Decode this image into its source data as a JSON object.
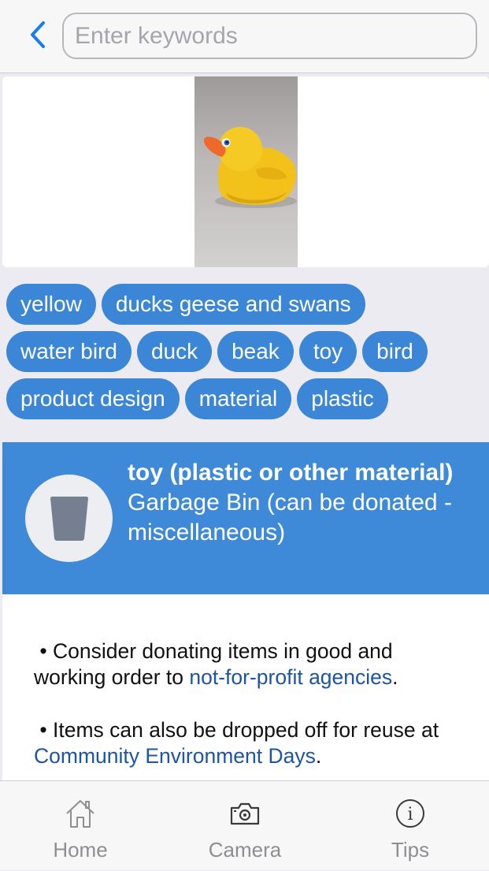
{
  "header": {
    "back_icon": "chevron-left-icon",
    "search_placeholder": "Enter keywords",
    "search_value": ""
  },
  "photo": {
    "subject": "yellow rubber duck"
  },
  "tags": [
    "yellow",
    "ducks geese and swans",
    "water bird",
    "duck",
    "beak",
    "toy",
    "bird",
    "product design",
    "material",
    "plastic"
  ],
  "result": {
    "icon": "garbage-bin-icon",
    "title": "toy (plastic or other material)",
    "bin": "Garbage Bin (can be donated - miscellaneous)"
  },
  "info": {
    "para1_text": "Consider donating items in good and working order to ",
    "para1_link": "not-for-profit agencies",
    "para1_end": ".",
    "para2_text": "Items can also be dropped off for reuse at ",
    "para2_link": "Community Environment Days",
    "para2_end": "."
  },
  "tabbar": {
    "home": "Home",
    "camera": "Camera",
    "tips": "Tips"
  },
  "colors": {
    "accent": "#3b86d6",
    "banner": "#3e8ad8",
    "link": "#1d55a2",
    "ios_blue": "#1a7cf5"
  }
}
